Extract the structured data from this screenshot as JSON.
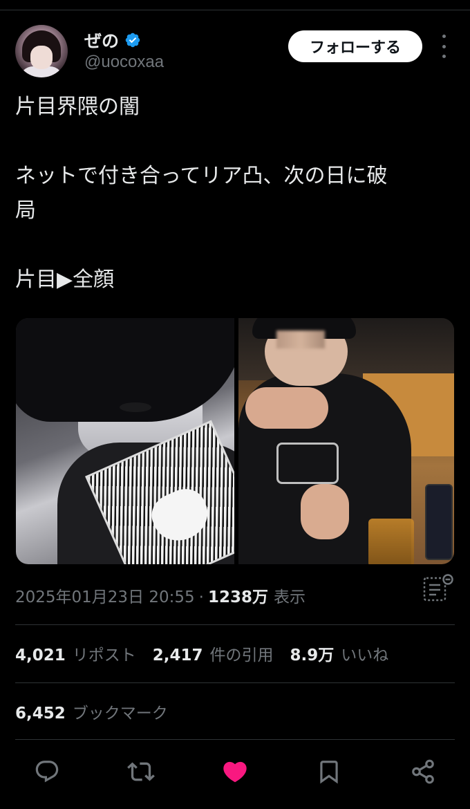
{
  "author": {
    "display_name": "ぜの",
    "handle": "@uocoxaa",
    "verified": true
  },
  "follow_label": "フォローする",
  "tweet": {
    "text": "片目界隈の闇\n\nネットで付き合ってリア凸、次の日に破\n局\n\n片目▶全顔"
  },
  "meta": {
    "timestamp": "2025年01月23日 20:55",
    "separator": "·",
    "views_count": "1238万",
    "views_label": "表示"
  },
  "stats": {
    "reposts_count": "4,021",
    "reposts_label": "リポスト",
    "quotes_count": "2,417",
    "quotes_label": "件の引用",
    "likes_count": "8.9万",
    "likes_label": "いいね",
    "bookmarks_count": "6,452",
    "bookmarks_label": "ブックマーク"
  },
  "actions": [
    {
      "icon": "reply-icon"
    },
    {
      "icon": "repost-icon"
    },
    {
      "icon": "like-icon",
      "active": true
    },
    {
      "icon": "bookmark-icon"
    },
    {
      "icon": "share-icon"
    }
  ],
  "colors": {
    "background": "#000000",
    "text": "#e7e9ea",
    "muted": "#71767b",
    "verified": "#1d9bf0",
    "like": "#f91880",
    "divider": "#2f3336"
  }
}
